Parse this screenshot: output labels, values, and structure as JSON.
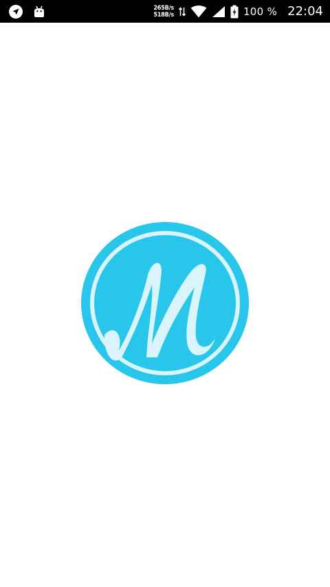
{
  "status_bar": {
    "icons": {
      "left": [
        "navigation-arrow-icon",
        "android-debug-icon"
      ],
      "right": [
        "data-transfer-icon",
        "wifi-icon",
        "cellular-signal-icon",
        "battery-charging-icon"
      ]
    },
    "net_speed_up": "265B/s",
    "net_speed_down": "518B/s",
    "battery_percent": "100 %",
    "time": "22:04"
  },
  "splash": {
    "logo_icon": "m-letter-logo-icon",
    "logo_letter": "M",
    "colors": {
      "logo_outer": "#29C6EC",
      "logo_ring": "#D9F4FA",
      "logo_letter": "#D9F4FA"
    }
  },
  "colors": {
    "status_bar_bg": "#000000",
    "page_bg": "#FFFFFF"
  }
}
